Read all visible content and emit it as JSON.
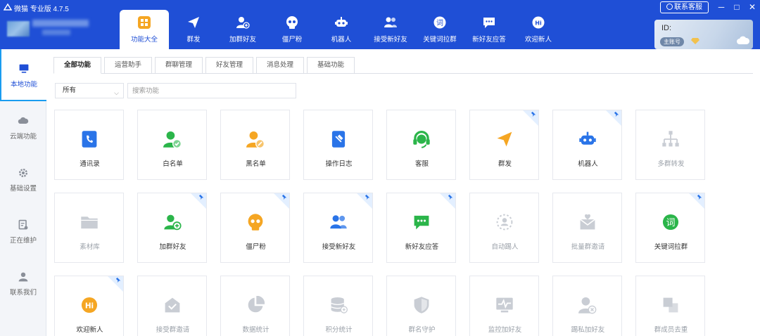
{
  "window": {
    "title": "微猫 专业版 4.7.5",
    "service_label": "联系客服",
    "minimize": "─",
    "maximize": "□",
    "close": "✕"
  },
  "colors": {
    "brand": "#1f4fd6",
    "accent": "#1a9cf0",
    "green": "#2bb54a",
    "orange": "#f5a623",
    "grey": "#c9cdd4"
  },
  "nav": [
    {
      "label": "功能大全",
      "icon": "grid-icon"
    },
    {
      "label": "群发",
      "icon": "paper-plane-icon"
    },
    {
      "label": "加群好友",
      "icon": "add-user-icon"
    },
    {
      "label": "僵尸粉",
      "icon": "skull-icon"
    },
    {
      "label": "机器人",
      "icon": "robot-icon"
    },
    {
      "label": "接受新好友",
      "icon": "users-icon"
    },
    {
      "label": "关键词拉群",
      "icon": "keyword-icon"
    },
    {
      "label": "新好友应答",
      "icon": "chat-icon"
    },
    {
      "label": "欢迎新人",
      "icon": "hi-icon"
    }
  ],
  "account": {
    "id_label": "ID:",
    "badge": "主账号"
  },
  "sidebar": [
    {
      "label": "本地功能",
      "icon": "monitor-icon"
    },
    {
      "label": "云端功能",
      "icon": "cloud-icon"
    },
    {
      "label": "基础设置",
      "icon": "gear-icon"
    },
    {
      "label": "正在维护",
      "icon": "maintenance-icon"
    },
    {
      "label": "联系我们",
      "icon": "person-icon"
    }
  ],
  "subtabs": [
    "全部功能",
    "运营助手",
    "群聊管理",
    "好友管理",
    "消息处理",
    "基础功能"
  ],
  "filter": {
    "selected": "所有",
    "search_placeholder": "搜索功能"
  },
  "cards": [
    {
      "label": "通讯录",
      "icon": "contacts-icon",
      "enabled": true,
      "pinned": false
    },
    {
      "label": "白名单",
      "icon": "whitelist-icon",
      "enabled": true,
      "pinned": false
    },
    {
      "label": "黑名单",
      "icon": "blacklist-icon",
      "enabled": true,
      "pinned": false
    },
    {
      "label": "操作日志",
      "icon": "log-icon",
      "enabled": true,
      "pinned": false
    },
    {
      "label": "客服",
      "icon": "headset-icon",
      "enabled": true,
      "pinned": false
    },
    {
      "label": "群发",
      "icon": "paper-plane-icon",
      "enabled": true,
      "pinned": true
    },
    {
      "label": "机器人",
      "icon": "robot-icon",
      "enabled": true,
      "pinned": true
    },
    {
      "label": "多群转发",
      "icon": "hierarchy-icon",
      "enabled": false,
      "pinned": false
    },
    {
      "label": "素材库",
      "icon": "folder-icon",
      "enabled": false,
      "pinned": false
    },
    {
      "label": "加群好友",
      "icon": "add-user-icon",
      "enabled": true,
      "pinned": true
    },
    {
      "label": "僵尸粉",
      "icon": "skull-icon",
      "enabled": true,
      "pinned": true
    },
    {
      "label": "接受新好友",
      "icon": "users-icon",
      "enabled": true,
      "pinned": true
    },
    {
      "label": "新好友应答",
      "icon": "chat-icon",
      "enabled": true,
      "pinned": true
    },
    {
      "label": "自动踢人",
      "icon": "kick-icon",
      "enabled": false,
      "pinned": false
    },
    {
      "label": "批量群邀请",
      "icon": "invite-icon",
      "enabled": false,
      "pinned": false
    },
    {
      "label": "关键词拉群",
      "icon": "keyword-icon",
      "enabled": true,
      "pinned": true
    },
    {
      "label": "欢迎新人",
      "icon": "hi-icon",
      "enabled": true,
      "pinned": true
    },
    {
      "label": "接受群邀请",
      "icon": "accept-invite-icon",
      "enabled": false,
      "pinned": false
    },
    {
      "label": "数据统计",
      "icon": "pie-chart-icon",
      "enabled": false,
      "pinned": false
    },
    {
      "label": "积分统计",
      "icon": "database-icon",
      "enabled": false,
      "pinned": false
    },
    {
      "label": "群名守护",
      "icon": "shield-icon",
      "enabled": false,
      "pinned": false
    },
    {
      "label": "监控加好友",
      "icon": "monitor-pulse-icon",
      "enabled": false,
      "pinned": false
    },
    {
      "label": "踢私加好友",
      "icon": "remove-user-icon",
      "enabled": false,
      "pinned": false
    },
    {
      "label": "群成员去重",
      "icon": "dedupe-icon",
      "enabled": false,
      "pinned": false
    }
  ]
}
